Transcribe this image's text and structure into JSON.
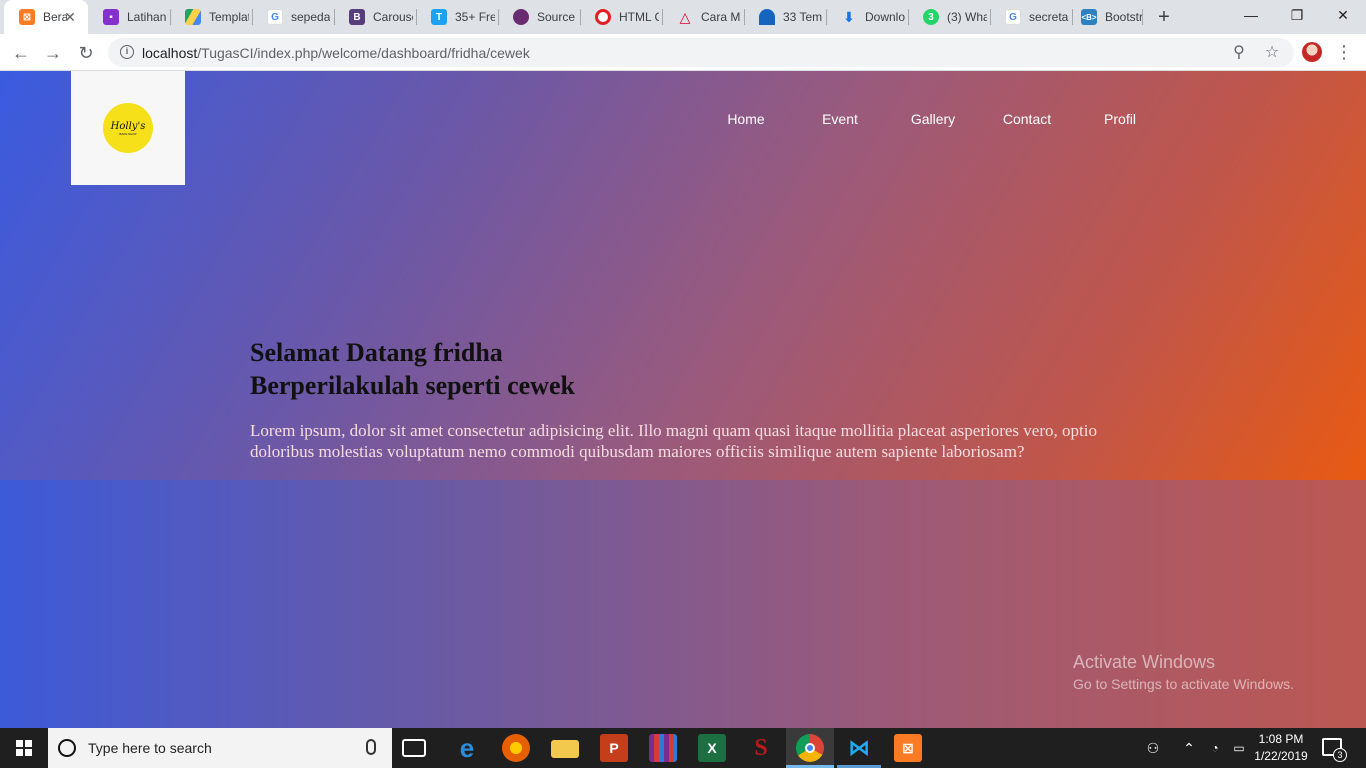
{
  "browser": {
    "tabs": [
      {
        "title": "Bera",
        "icon": "xampp-icon",
        "color": "#fb7a24",
        "active": true
      },
      {
        "title": "Latihan",
        "icon": "classroom-icon",
        "color": "#8430ce"
      },
      {
        "title": "Templat",
        "icon": "drive-icon",
        "color": "#1fa463"
      },
      {
        "title": "sepeda",
        "icon": "google-icon",
        "color": "#4285f4"
      },
      {
        "title": "Carouse",
        "icon": "bootstrap-icon",
        "color": "#563d7c"
      },
      {
        "title": "35+ Fre",
        "icon": "t-icon",
        "color": "#1da1f2"
      },
      {
        "title": "Source",
        "icon": "source-icon",
        "color": "#6a2c70"
      },
      {
        "title": "HTML C",
        "icon": "opera-icon",
        "color": "#e31e24"
      },
      {
        "title": "Cara M",
        "icon": "angular-icon",
        "color": "#dd0031"
      },
      {
        "title": "33 Tem",
        "icon": "template-icon",
        "color": "#1565c0"
      },
      {
        "title": "Downlo",
        "icon": "download-icon",
        "color": "#1a73e8"
      },
      {
        "title": "(3) Wha",
        "icon": "whatsapp-icon",
        "color": "#25d366"
      },
      {
        "title": "secretar",
        "icon": "google-icon",
        "color": "#4285f4"
      },
      {
        "title": "Bootstr",
        "icon": "bootstrap-icon",
        "color": "#2f80c0"
      }
    ],
    "url_host": "localhost",
    "url_path": "/TugasCI/index.php/welcome/dashboard/fridha/cewek"
  },
  "page": {
    "logo_text": "Holly's",
    "logo_sub": "BAKE SHOP",
    "nav": [
      "Home",
      "Event",
      "Gallery",
      "Contact",
      "Profil"
    ],
    "title_line1": "Selamat Datang fridha",
    "title_line2": "Berperilakulah seperti cewek",
    "body": "Lorem ipsum, dolor sit amet consectetur adipisicing elit. Illo magni quam quasi itaque mollitia placeat asperiores vero, optio doloribus molestias voluptatum nemo commodi quibusdam maiores officiis similique autem sapiente laboriosam?"
  },
  "watermark": {
    "line1": "Activate Windows",
    "line2": "Go to Settings to activate Windows."
  },
  "taskbar": {
    "search_placeholder": "Type here to search",
    "time": "1:08 PM",
    "date": "1/22/2019",
    "notification_count": "3"
  }
}
